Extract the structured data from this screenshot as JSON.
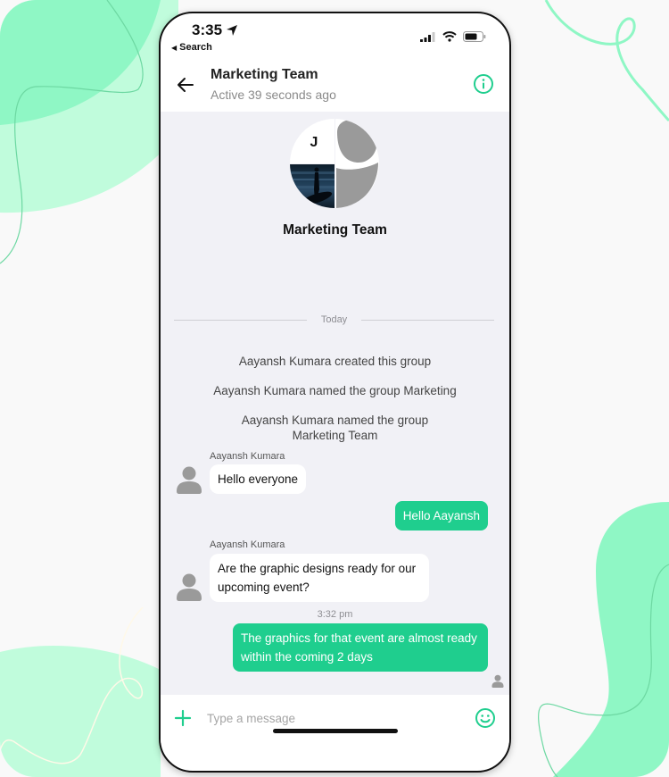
{
  "status_bar": {
    "time": "3:35",
    "back_app_label": "Search",
    "icons": [
      "location-arrow-icon",
      "signal-icon",
      "wifi-icon",
      "battery-icon"
    ]
  },
  "header": {
    "title": "Marketing Team",
    "subtitle": "Active 39 seconds ago",
    "back_icon": "arrow-left-icon",
    "info_icon": "info-icon"
  },
  "group": {
    "avatar_initial": "J",
    "name": "Marketing Team"
  },
  "chat": {
    "date_divider": "Today",
    "system_messages": [
      "Aayansh Kumara created this group",
      "Aayansh Kumara named the group Marketing",
      "Aayansh Kumara named the group Marketing Team"
    ],
    "messages": [
      {
        "direction": "incoming",
        "sender": "Aayansh Kumara",
        "text": "Hello everyone"
      },
      {
        "direction": "outgoing",
        "text": "Hello Aayansh"
      },
      {
        "direction": "incoming",
        "sender": "Aayansh Kumara",
        "text": "Are the graphic designs ready for our upcoming event?"
      },
      {
        "direction": "outgoing",
        "timestamp": "3:32 pm",
        "text": "The graphics for that event are almost ready within the coming 2 days"
      }
    ]
  },
  "composer": {
    "placeholder": "Type a message",
    "value": "",
    "attach_icon": "plus-icon",
    "emoji_icon": "smiley-icon"
  },
  "colors": {
    "accent": "#1fce8e",
    "chat_background": "#f1f1f6",
    "background_blob": "#8ff7c5"
  }
}
